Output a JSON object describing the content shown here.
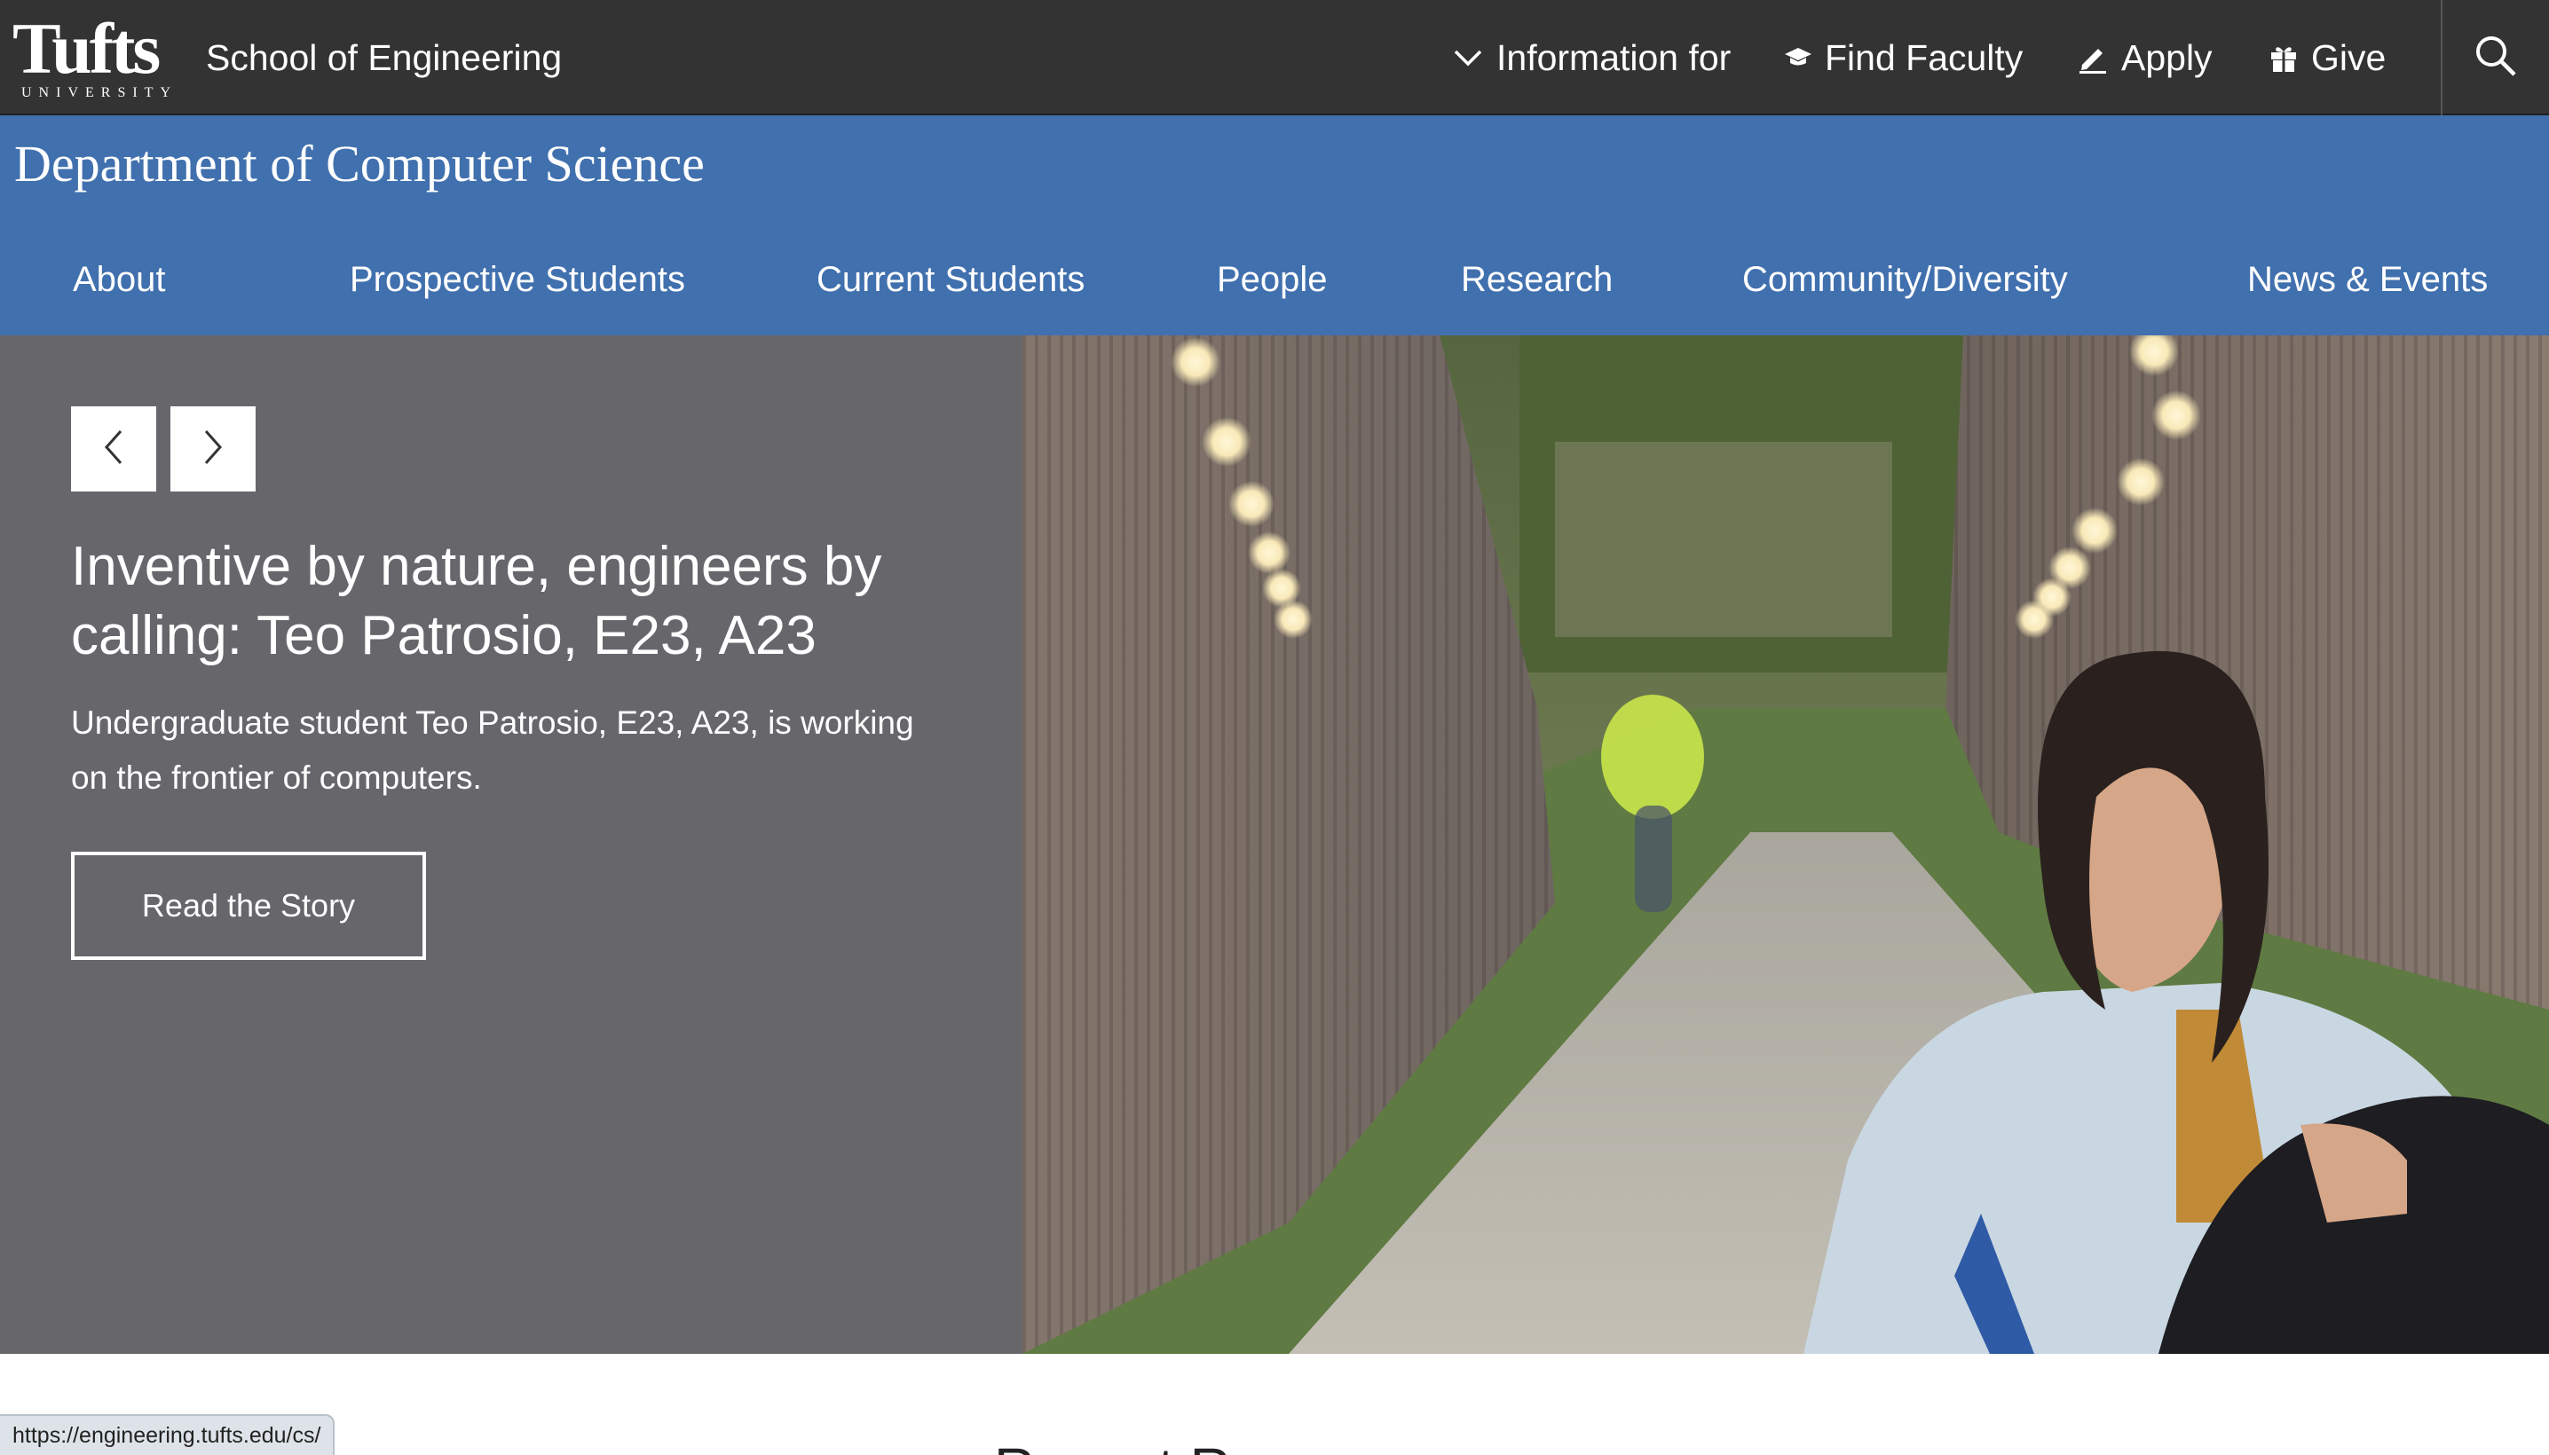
{
  "header": {
    "logo_text": "Tufts",
    "logo_subtext": "UNIVERSITY",
    "school_name": "School of Engineering",
    "nav": [
      {
        "label": "Information for",
        "icon": "chevron-down-icon"
      },
      {
        "label": "Find Faculty",
        "icon": "graduation-cap-icon"
      },
      {
        "label": "Apply",
        "icon": "pencil-icon"
      },
      {
        "label": "Give",
        "icon": "gift-icon"
      }
    ],
    "search_icon": "search-icon"
  },
  "department": {
    "title": "Department of Computer Science",
    "nav": [
      "About",
      "Prospective Students",
      "Current Students",
      "People",
      "Research",
      "Community/Diversity",
      "News & Events"
    ]
  },
  "hero": {
    "prev_icon": "chevron-left-icon",
    "next_icon": "chevron-right-icon",
    "title": "Inventive by nature, engineers by calling: Teo Patrosio, E23, A23",
    "description": "Undergraduate student Teo Patrosio, E23, A23, is working on the frontier of computers.",
    "cta_label": "Read the Story"
  },
  "below": {
    "heading": "Recent Resea"
  },
  "status_bar": {
    "url": "https://engineering.tufts.edu/cs/"
  },
  "colors": {
    "top_bar": "#333333",
    "department_band": "#4170ae",
    "hero_panel": "#67666b"
  }
}
